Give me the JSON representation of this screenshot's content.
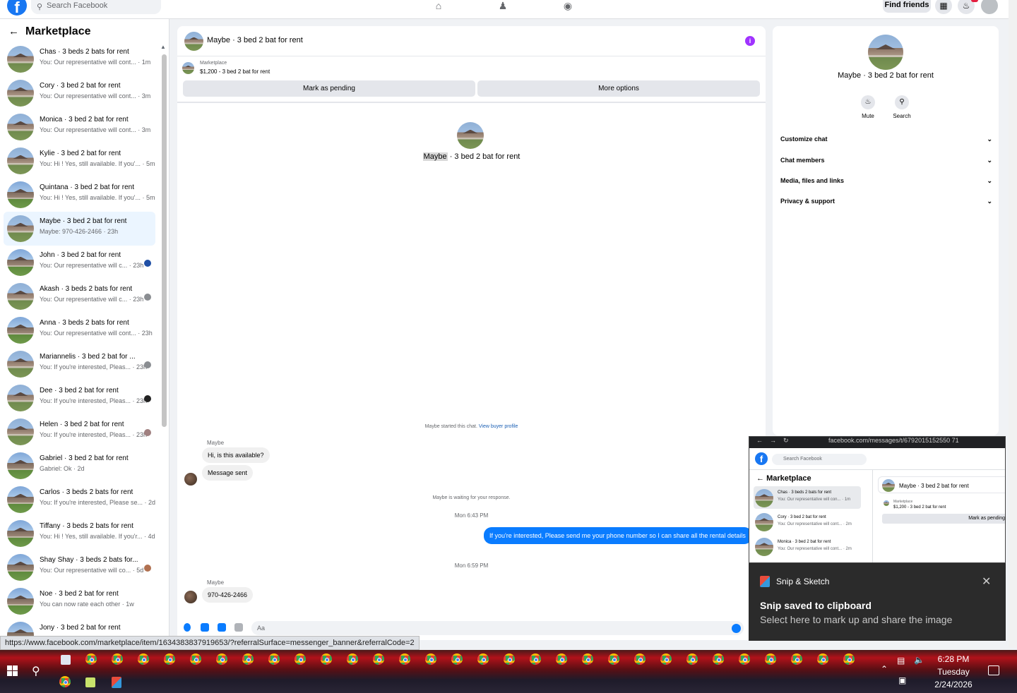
{
  "topbar": {
    "search_placeholder": "Search Facebook",
    "find_friends": "Find friends"
  },
  "sidebar": {
    "title": "Marketplace",
    "conversations": [
      {
        "name": "Chas · 3 beds 2 bats for rent",
        "preview": "You: Our representative will cont... · 1m"
      },
      {
        "name": "Cory · 3 bed 2 bat for rent",
        "preview": "You: Our representative will cont... · 3m"
      },
      {
        "name": "Monica · 3 bed 2 bat for rent",
        "preview": "You: Our representative will cont... · 3m"
      },
      {
        "name": "Kylie · 3 bed 2 bat for rent",
        "preview": "You: Hi ! Yes, still available. If you'... · 5m"
      },
      {
        "name": "Quintana · 3 bed 2 bat for rent",
        "preview": "You: Hi ! Yes, still available. If you'... · 5m"
      },
      {
        "name": "Maybe · 3 bed 2 bat for rent",
        "preview": "Maybe: 970-426-2466 · 23h"
      },
      {
        "name": "John · 3 bed 2 bat for rent",
        "preview": "You: Our representative will c... · 23h"
      },
      {
        "name": "Akash · 3 beds 2 bats for rent",
        "preview": "You: Our representative will c... · 23h"
      },
      {
        "name": "Anna · 3 beds 2 bats for rent",
        "preview": "You: Our representative will cont... · 23h"
      },
      {
        "name": "Mariannelis · 3 bed 2 bat for ...",
        "preview": "You: If you're interested, Pleas... · 23h"
      },
      {
        "name": "Dee · 3 bed 2 bat for rent",
        "preview": "You: If you're interested, Pleas... · 23h"
      },
      {
        "name": "Helen · 3 bed 2 bat for rent",
        "preview": "You: If you're interested, Pleas... · 23h"
      },
      {
        "name": "Gabriel · 3 bed 2 bat for rent",
        "preview": "Gabriel: Ok · 2d"
      },
      {
        "name": "Carlos · 3 beds 2 bats for rent",
        "preview": "You: If you're interested, Please se... · 2d"
      },
      {
        "name": "Tiffany · 3 beds 2 bats for rent",
        "preview": "You: Hi ! Yes, still available. If you'r... · 4d"
      },
      {
        "name": "Shay Shay · 3 beds 2 bats for...",
        "preview": "You: Our representative will co... · 5d"
      },
      {
        "name": "Noe · 3 bed 2 bat for rent",
        "preview": "You can now rate each other · 1w"
      },
      {
        "name": "Jony · 3 bed 2 bat for rent",
        "preview": ""
      }
    ]
  },
  "chat": {
    "title": "Maybe · 3 bed 2 bat for rent",
    "listing_label": "Marketplace",
    "listing_price": "$1,200 - 3 bed 2 bat for rent",
    "mark_pending": "Mark as pending",
    "more_options": "More options",
    "title_name": "Maybe",
    "title_rest": " · 3 bed 2 bat for rent",
    "started_text": "Maybe started this chat.",
    "view_profile": "View buyer profile",
    "sender": "Maybe",
    "msg1": "Hi, is this available?",
    "msg2": "Message sent",
    "waiting": "Maybe is waiting for your response.",
    "time1": "Mon 6:43 PM",
    "outgoing": "If you're interested, Please send me your phone number so I can share all the rental details",
    "time2": "Mon 6:59 PM",
    "msg3": "970-426-2466",
    "composer_placeholder": "Aa"
  },
  "info_panel": {
    "title": "Maybe · 3 bed 2 bat for rent",
    "mute": "Mute",
    "search": "Search",
    "rows": [
      "Customize chat",
      "Chat members",
      "Media, files and links",
      "Privacy & support"
    ]
  },
  "snip_preview": {
    "url": "facebook.com/messages/t/6792015152550 71",
    "search": "Search Facebook",
    "title": "Marketplace",
    "chat_title": "Maybe · 3 bed 2 bat for rent",
    "listing_label": "Marketplace",
    "listing_price": "$1,200 - 3 bed 2 bat for rent",
    "mark_pending": "Mark as pending",
    "items": [
      {
        "name": "Chas · 3 beds 2 bats for rent",
        "preview": "You: Our representative will con... · 1m"
      },
      {
        "name": "Cory · 3 bed 2 bat for rent",
        "preview": "You: Our representative will cont... · 2m"
      },
      {
        "name": "Monica · 3 bed 2 bat for rent",
        "preview": "You: Our representative will cont... · 2m"
      }
    ]
  },
  "snip_toast": {
    "app": "Snip & Sketch",
    "title": "Snip saved to clipboard",
    "subtitle": "Select here to mark up and share the image"
  },
  "status_url": "https://www.facebook.com/marketplace/item/1634383837919653/?referralSurface=messenger_banner&referralCode=2",
  "clock": {
    "time": "6:28 PM",
    "day": "Tuesday",
    "date": "2/24/2026"
  }
}
